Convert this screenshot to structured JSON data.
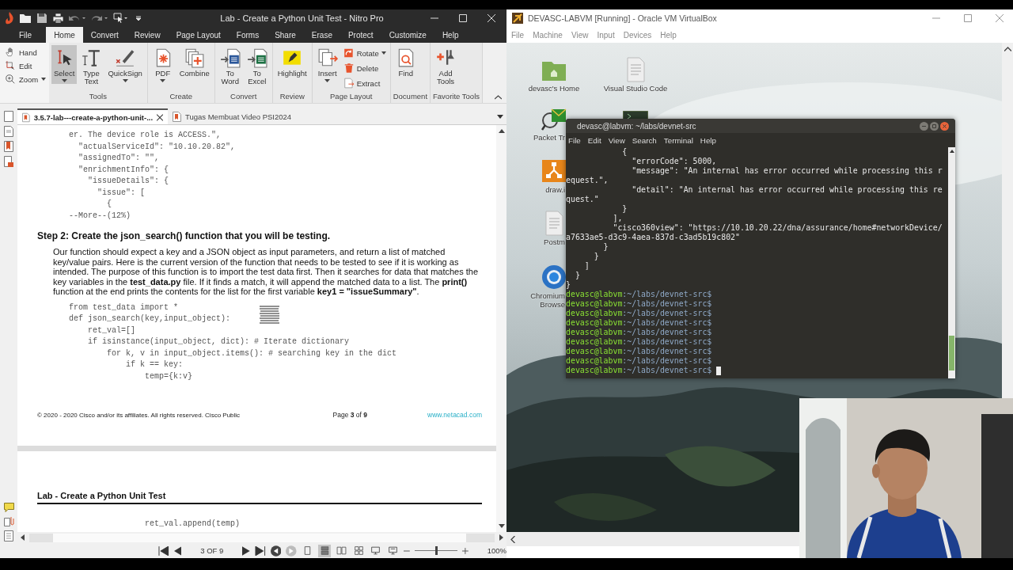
{
  "nitro": {
    "title": "Lab - Create a Python Unit Test - Nitro Pro",
    "menu_tabs": [
      {
        "label": "File",
        "selected": false
      },
      {
        "label": "Home",
        "selected": true
      },
      {
        "label": "Convert",
        "selected": false
      },
      {
        "label": "Review",
        "selected": false
      },
      {
        "label": "Page Layout",
        "selected": false
      },
      {
        "label": "Forms",
        "selected": false
      },
      {
        "label": "Share",
        "selected": false
      },
      {
        "label": "Erase",
        "selected": false
      },
      {
        "label": "Protect",
        "selected": false
      },
      {
        "label": "Customize",
        "selected": false
      },
      {
        "label": "Help",
        "selected": false
      }
    ],
    "nav_tools": [
      {
        "label": "Hand",
        "dropdown": false
      },
      {
        "label": "Edit",
        "dropdown": false
      },
      {
        "label": "Zoom",
        "dropdown": true
      }
    ],
    "ribbon_groups": [
      {
        "label": "Tools",
        "tools": [
          {
            "label": "Select",
            "kind": "large",
            "dropdown": true,
            "selected": true
          },
          {
            "label": "Type Text",
            "kind": "large",
            "dropdown": false,
            "selected": false
          },
          {
            "label": "QuickSign",
            "kind": "large",
            "dropdown": true,
            "selected": false
          }
        ]
      },
      {
        "label": "Create",
        "tools": [
          {
            "label": "PDF",
            "kind": "large",
            "dropdown": true,
            "selected": false
          },
          {
            "label": "Combine",
            "kind": "large",
            "dropdown": false,
            "selected": false
          }
        ]
      },
      {
        "label": "Convert",
        "tools": [
          {
            "label": "To Word",
            "kind": "large",
            "dropdown": false,
            "selected": false
          },
          {
            "label": "To Excel",
            "kind": "large",
            "dropdown": false,
            "selected": false
          }
        ]
      },
      {
        "label": "Review",
        "tools": [
          {
            "label": "Highlight",
            "kind": "large",
            "dropdown": false,
            "selected": false
          }
        ]
      },
      {
        "label": "Page Layout",
        "tools": [
          {
            "label": "Insert",
            "kind": "large",
            "dropdown": true,
            "selected": false
          },
          {
            "label": "Rotate",
            "kind": "small",
            "dropdown": true,
            "selected": false
          },
          {
            "label": "Delete",
            "kind": "small",
            "dropdown": false,
            "selected": false
          },
          {
            "label": "Extract",
            "kind": "small",
            "dropdown": false,
            "selected": false
          }
        ]
      },
      {
        "label": "Document",
        "tools": [
          {
            "label": "Find",
            "kind": "large",
            "dropdown": false,
            "selected": false
          }
        ]
      },
      {
        "label": "Favorite Tools",
        "tools": [
          {
            "label": "Add Tools",
            "kind": "large",
            "dropdown": false,
            "selected": false
          }
        ]
      }
    ],
    "doc_tabs": [
      {
        "label": "3.5.7-lab---create-a-python-unit-...",
        "selected": true
      },
      {
        "label": "Tugas Membuat Video PSI2024",
        "selected": false
      }
    ],
    "page": {
      "code_top": [
        "er. The device role is ACCESS.\",",
        "  \"actualServiceId\": \"10.10.20.82\",",
        "  \"assignedTo\": \"\",",
        "  \"enrichmentInfo\": {",
        "    \"issueDetails\": {",
        "      \"issue\": [",
        "        {",
        "--More--(12%)"
      ],
      "heading": "Step 2: Create the json_search() function that you will be testing.",
      "paragraph": "Our function should expect a key and a JSON object as input parameters, and return a list of matched key/value pairs. Here is the current version of the function that needs to be tested to see if it is working as intended. The purpose of this function is to import the test data first. Then it searches for data that matches the key variables in the **test_data.py** file. If it finds a match, it will append the matched data to a list. The **print()** function at the end prints the contents for the list for the first variable **key1 = \"issueSummary\"**.",
      "code": [
        "from test_data import *",
        "def json_search(key,input_object):",
        "    ret_val=[]",
        "    if isinstance(input_object, dict): # Iterate dictionary",
        "        for k, v in input_object.items(): # searching key in the dict",
        "            if k == key:",
        "                temp={k:v}"
      ],
      "footer": {
        "copyright": "© 2020 - 2020 Cisco and/or its affiliates. All rights reserved. Cisco Public",
        "page_number": "Page **3** of **9**",
        "link": "www.netacad.com"
      }
    },
    "next_page": {
      "header": "Lab - Create a Python Unit Test",
      "code": [
        "                ret_val.append(temp)"
      ]
    },
    "navigation": {
      "page_indicator": "3 OF 9",
      "view_modes": [
        {
          "selected": false
        },
        {
          "selected": true
        },
        {
          "selected": false
        },
        {
          "selected": false
        },
        {
          "selected": false
        },
        {
          "selected": false
        }
      ],
      "zoom": {
        "level": 0.5,
        "reading": "100%"
      }
    }
  },
  "virtualbox": {
    "title": "DEVASC-LABVM [Running] - Oracle VM VirtualBox",
    "menu": [
      "File",
      "Machine",
      "View",
      "Input",
      "Devices",
      "Help"
    ],
    "desktop_icons": [
      {
        "label": "devasc's Home"
      },
      {
        "label": "Visual Studio Code"
      },
      {
        "label": "Packet Tr"
      },
      {
        "label": "draw.i"
      },
      {
        "label": "Postm"
      },
      {
        "label": "Chromium Browse"
      }
    ],
    "terminal": {
      "title": "devasc@labvm: ~/labs/devnet-src",
      "menu": [
        "File",
        "Edit",
        "View",
        "Search",
        "Terminal",
        "Help"
      ],
      "output": [
        "            {",
        "              \"errorCode\": 5000,",
        "              \"message\": \"An internal has error occurred while processing this r",
        "equest.\",",
        "              \"detail\": \"An internal has error occurred while processing this re",
        "quest.\"",
        "            }",
        "          ],",
        "          \"cisco360view\": \"https://10.10.20.22/dna/assurance/home#networkDevice/",
        "a7633ae5-d3c9-4aea-837d-c3ad5b19c802\"",
        "        }",
        "      }",
        "    ]",
        "  }",
        "}"
      ],
      "prompts": [
        {
          "user": "devasc@labvm",
          "path": ":~/labs/devnet-src$",
          "cursor": false
        },
        {
          "user": "devasc@labvm",
          "path": ":~/labs/devnet-src$",
          "cursor": false
        },
        {
          "user": "devasc@labvm",
          "path": ":~/labs/devnet-src$",
          "cursor": false
        },
        {
          "user": "devasc@labvm",
          "path": ":~/labs/devnet-src$",
          "cursor": false
        },
        {
          "user": "devasc@labvm",
          "path": ":~/labs/devnet-src$",
          "cursor": false
        },
        {
          "user": "devasc@labvm",
          "path": ":~/labs/devnet-src$",
          "cursor": false
        },
        {
          "user": "devasc@labvm",
          "path": ":~/labs/devnet-src$",
          "cursor": false
        },
        {
          "user": "devasc@labvm",
          "path": ":~/labs/devnet-src$",
          "cursor": false
        },
        {
          "user": "devasc@labvm",
          "path": ":~/labs/devnet-src$",
          "cursor": true
        }
      ]
    }
  }
}
